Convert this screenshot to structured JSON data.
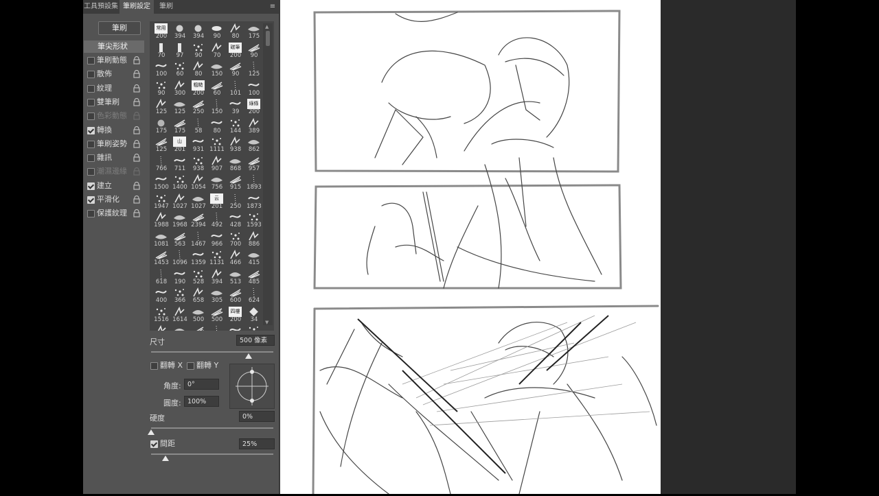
{
  "tabs": [
    {
      "label": "工具預設集"
    },
    {
      "label": "筆刷設定"
    },
    {
      "label": "筆刷"
    }
  ],
  "panel_menu_icon": "menu-icon",
  "brush_button": "筆刷",
  "tip_shape_label": "筆尖形狀",
  "options": [
    {
      "label": "筆刷動態",
      "checked": false,
      "dim": false
    },
    {
      "label": "散佈",
      "checked": false,
      "dim": false
    },
    {
      "label": "紋理",
      "checked": false,
      "dim": false
    },
    {
      "label": "雙筆刷",
      "checked": false,
      "dim": false
    },
    {
      "label": "色彩動態",
      "checked": false,
      "dim": true
    },
    {
      "label": "轉換",
      "checked": true,
      "dim": false
    },
    {
      "label": "筆刷姿勢",
      "checked": false,
      "dim": false
    },
    {
      "label": "雜訊",
      "checked": false,
      "dim": false
    },
    {
      "label": "潮濕邊緣",
      "checked": false,
      "dim": true
    },
    {
      "label": "建立",
      "checked": true,
      "dim": false
    },
    {
      "label": "平滑化",
      "checked": true,
      "dim": false
    },
    {
      "label": "保護紋理",
      "checked": false,
      "dim": false
    }
  ],
  "brush_sizes": [
    [
      "200",
      "394",
      "394",
      "90",
      "80",
      "175"
    ],
    [
      "70",
      "97",
      "90",
      "70",
      "200",
      "90"
    ],
    [
      "100",
      "60",
      "80",
      "150",
      "90",
      "125"
    ],
    [
      "90",
      "300",
      "200",
      "60",
      "101",
      "100"
    ],
    [
      "125",
      "125",
      "250",
      "150",
      "39",
      "200"
    ],
    [
      "175",
      "175",
      "58",
      "80",
      "144",
      "389"
    ],
    [
      "125",
      "201",
      "931",
      "1111",
      "938",
      "862"
    ],
    [
      "766",
      "711",
      "938",
      "907",
      "868",
      "957"
    ],
    [
      "1500",
      "1400",
      "1054",
      "756",
      "915",
      "1893"
    ],
    [
      "1947",
      "1027",
      "1027",
      "201",
      "250",
      "1873"
    ],
    [
      "1988",
      "1968",
      "2394",
      "492",
      "428",
      "1593"
    ],
    [
      "1081",
      "563",
      "1467",
      "966",
      "700",
      "886"
    ],
    [
      "1453",
      "1096",
      "1359",
      "1131",
      "466",
      "415"
    ],
    [
      "618",
      "190",
      "528",
      "394",
      "513",
      "485"
    ],
    [
      "400",
      "366",
      "658",
      "305",
      "600",
      "624"
    ],
    [
      "1516",
      "1614",
      "500",
      "500",
      "200",
      "34"
    ]
  ],
  "brush_text_tips": {
    "0-0": "常用",
    "1-4": "碳筆",
    "3-2": "粗糙",
    "4-5": "綠條",
    "6-1": "山",
    "9-3": "云",
    "15-4": "四樓"
  },
  "size": {
    "label": "尺寸",
    "value": "500 像素",
    "fraction": 0.8
  },
  "flip_x": {
    "label": "翻轉 X",
    "checked": false
  },
  "flip_y": {
    "label": "翻轉 Y",
    "checked": false
  },
  "angle": {
    "label": "角度:",
    "value": "0°"
  },
  "roundness": {
    "label": "圓度:",
    "value": "100%"
  },
  "hardness": {
    "label": "硬度",
    "value": "0%",
    "fraction": 0.0
  },
  "spacing": {
    "label": "間距",
    "value": "25%",
    "checked": true,
    "fraction": 0.12
  },
  "colors": {
    "panel": "#535353",
    "grid_bg": "#454545",
    "canvas": "#ffffff",
    "ink": "#3a3a3a"
  }
}
